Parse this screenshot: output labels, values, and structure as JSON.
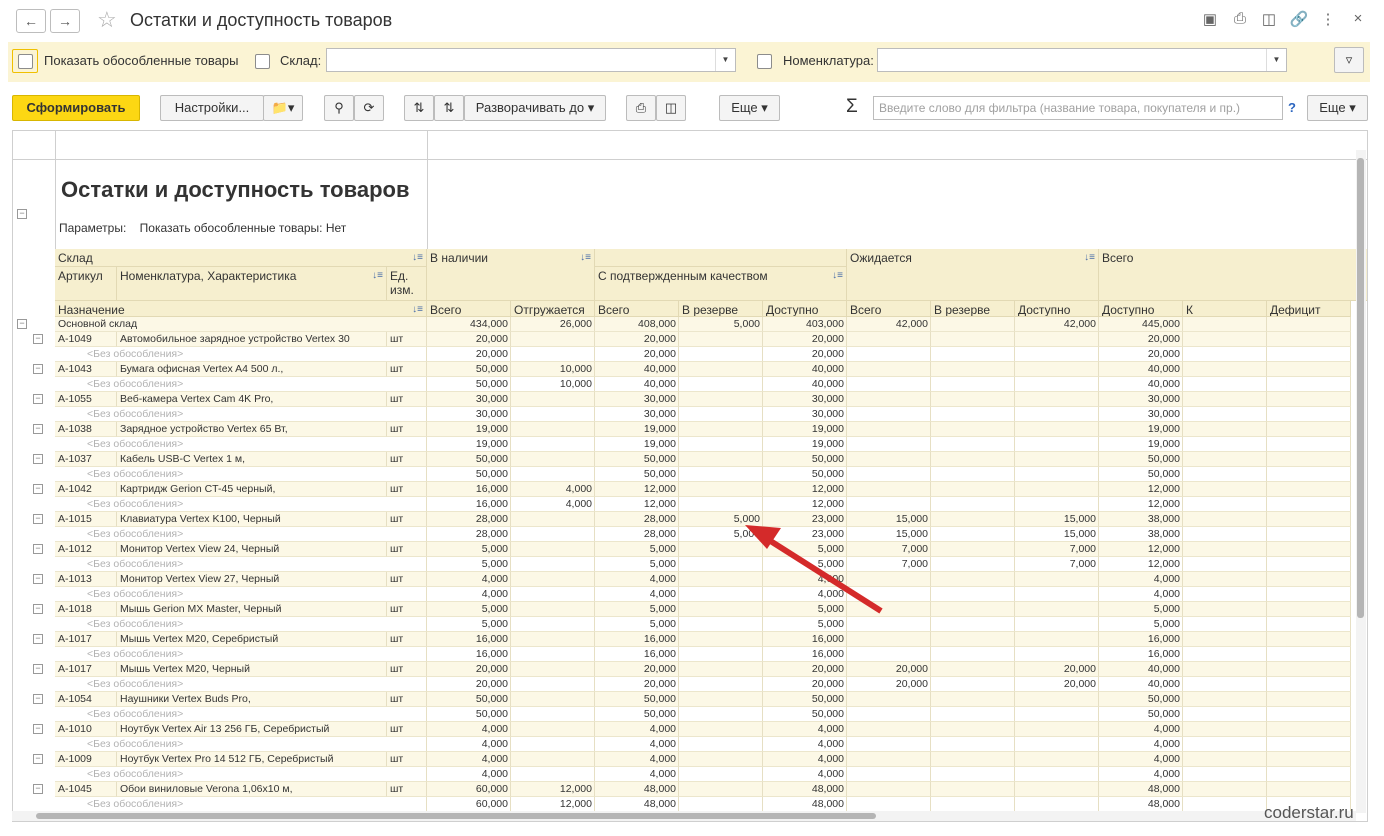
{
  "window": {
    "title": "Остатки и доступность товаров"
  },
  "filters": {
    "show_isolated": "Показать обособленные товары",
    "warehouse_label": "Склад:",
    "warehouse_value": "",
    "nomenclature_label": "Номенклатура:",
    "nomenclature_value": ""
  },
  "toolbar": {
    "generate": "Сформировать",
    "settings": "Настройки...",
    "expand_to": "Разворачивать до",
    "more": "Еще",
    "more2": "Еще",
    "sigma": "Σ",
    "help": "?",
    "search_placeholder": "Введите слово для фильтра (название товара, покупателя и пр.)"
  },
  "report": {
    "title": "Остатки и доступность товаров",
    "params_label": "Параметры:",
    "params_value": "Показать обособленные товары: Нет"
  },
  "headers": {
    "sklad": "Склад",
    "artikul": "Артикул",
    "nomenklatura": "Номенклатура, Характеристика",
    "ed": "Ед. изм.",
    "naznachenie": "Назначение",
    "v_nalichii": "В наличии",
    "s_kachestvom": "С подтвержденным качеством",
    "ozhidaetsya": "Ожидается",
    "vsego_grp": "Всего",
    "cols": [
      "Всего",
      "Отгружается",
      "Всего",
      "В резерве",
      "Доступно",
      "Всего",
      "В резерве",
      "Доступно",
      "Доступно",
      "К",
      "Дефицит"
    ]
  },
  "total_row": {
    "name": "Основной склад",
    "vals": [
      "434,000",
      "26,000",
      "408,000",
      "5,000",
      "403,000",
      "42,000",
      "",
      "42,000",
      "445,000",
      "",
      ""
    ]
  },
  "no_isolation": "<Без обособления>",
  "items": [
    {
      "art": "А-1049",
      "name": "Автомобильное зарядное устройство Vertex 30",
      "ed": "шт",
      "vals": [
        "20,000",
        "",
        "20,000",
        "",
        "20,000",
        "",
        "",
        "",
        "20,000",
        "",
        ""
      ]
    },
    {
      "art": "А-1043",
      "name": "Бумага офисная Vertex A4 500 л.,",
      "ed": "шт",
      "vals": [
        "50,000",
        "10,000",
        "40,000",
        "",
        "40,000",
        "",
        "",
        "",
        "40,000",
        "",
        ""
      ]
    },
    {
      "art": "А-1055",
      "name": "Веб-камера Vertex Cam 4K Pro,",
      "ed": "шт",
      "vals": [
        "30,000",
        "",
        "30,000",
        "",
        "30,000",
        "",
        "",
        "",
        "30,000",
        "",
        ""
      ]
    },
    {
      "art": "А-1038",
      "name": "Зарядное устройство Vertex 65 Вт,",
      "ed": "шт",
      "vals": [
        "19,000",
        "",
        "19,000",
        "",
        "19,000",
        "",
        "",
        "",
        "19,000",
        "",
        ""
      ]
    },
    {
      "art": "А-1037",
      "name": "Кабель USB-C Vertex 1 м,",
      "ed": "шт",
      "vals": [
        "50,000",
        "",
        "50,000",
        "",
        "50,000",
        "",
        "",
        "",
        "50,000",
        "",
        ""
      ]
    },
    {
      "art": "А-1042",
      "name": "Картридж Gerion CT-45 черный,",
      "ed": "шт",
      "vals": [
        "16,000",
        "4,000",
        "12,000",
        "",
        "12,000",
        "",
        "",
        "",
        "12,000",
        "",
        ""
      ]
    },
    {
      "art": "А-1015",
      "name": "Клавиатура Vertex K100, Черный",
      "ed": "шт",
      "vals": [
        "28,000",
        "",
        "28,000",
        "5,000",
        "23,000",
        "15,000",
        "",
        "15,000",
        "38,000",
        "",
        ""
      ]
    },
    {
      "art": "А-1012",
      "name": "Монитор Vertex View 24, Черный",
      "ed": "шт",
      "vals": [
        "5,000",
        "",
        "5,000",
        "",
        "5,000",
        "7,000",
        "",
        "7,000",
        "12,000",
        "",
        ""
      ]
    },
    {
      "art": "А-1013",
      "name": "Монитор Vertex View 27, Черный",
      "ed": "шт",
      "vals": [
        "4,000",
        "",
        "4,000",
        "",
        "4,000",
        "",
        "",
        "",
        "4,000",
        "",
        ""
      ]
    },
    {
      "art": "А-1018",
      "name": "Мышь Gerion MX Master, Черный",
      "ed": "шт",
      "vals": [
        "5,000",
        "",
        "5,000",
        "",
        "5,000",
        "",
        "",
        "",
        "5,000",
        "",
        ""
      ]
    },
    {
      "art": "А-1017",
      "name": "Мышь Vertex M20, Серебристый",
      "ed": "шт",
      "vals": [
        "16,000",
        "",
        "16,000",
        "",
        "16,000",
        "",
        "",
        "",
        "16,000",
        "",
        ""
      ]
    },
    {
      "art": "А-1017",
      "name": "Мышь Vertex M20, Черный",
      "ed": "шт",
      "vals": [
        "20,000",
        "",
        "20,000",
        "",
        "20,000",
        "20,000",
        "",
        "20,000",
        "40,000",
        "",
        ""
      ]
    },
    {
      "art": "А-1054",
      "name": "Наушники Vertex Buds Pro,",
      "ed": "шт",
      "vals": [
        "50,000",
        "",
        "50,000",
        "",
        "50,000",
        "",
        "",
        "",
        "50,000",
        "",
        ""
      ]
    },
    {
      "art": "А-1010",
      "name": "Ноутбук Vertex Air 13 256 ГБ, Серебристый",
      "ed": "шт",
      "vals": [
        "4,000",
        "",
        "4,000",
        "",
        "4,000",
        "",
        "",
        "",
        "4,000",
        "",
        ""
      ]
    },
    {
      "art": "А-1009",
      "name": "Ноутбук Vertex Pro 14 512 ГБ, Серебристый",
      "ed": "шт",
      "vals": [
        "4,000",
        "",
        "4,000",
        "",
        "4,000",
        "",
        "",
        "",
        "4,000",
        "",
        ""
      ]
    },
    {
      "art": "А-1045",
      "name": "Обои виниловые Verona 1,06x10 м,",
      "ed": "шт",
      "vals": [
        "60,000",
        "12,000",
        "48,000",
        "",
        "48,000",
        "",
        "",
        "",
        "48,000",
        "",
        ""
      ]
    }
  ],
  "watermark": "coderstar.ru"
}
